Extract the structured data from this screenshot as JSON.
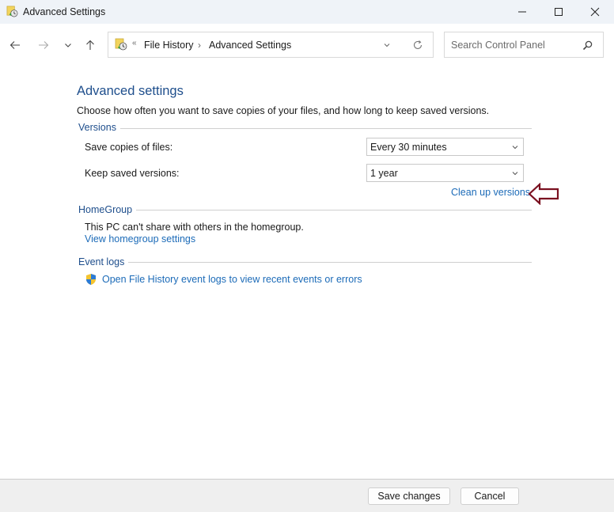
{
  "window": {
    "title": "Advanced Settings",
    "icon": "file-history-icon",
    "controls": {
      "minimize": "minimize-icon",
      "maximize": "maximize-icon",
      "close": "close-icon"
    }
  },
  "navigation": {
    "back": "arrow-left-icon",
    "forward": "arrow-right-icon",
    "recent": "chevron-down-icon",
    "up": "arrow-up-icon",
    "address": {
      "overflow": "«",
      "breadcrumbs": [
        "File History",
        "Advanced Settings"
      ],
      "separator": "›"
    },
    "search": {
      "placeholder": "Search Control Panel",
      "value": ""
    }
  },
  "main": {
    "heading": "Advanced settings",
    "description": "Choose how often you want to save copies of your files, and how long to keep saved versions.",
    "versions": {
      "label": "Versions",
      "save_copies_label": "Save copies of files:",
      "save_copies_value": "Every 30 minutes",
      "keep_versions_label": "Keep saved versions:",
      "keep_versions_value": "1 year",
      "cleanup_link": "Clean up versions"
    },
    "homegroup": {
      "label": "HomeGroup",
      "status": "This PC can't share with others in the homegroup.",
      "settings_link": "View homegroup settings"
    },
    "event_logs": {
      "label": "Event logs",
      "open_link": "Open File History event logs to view recent events or errors"
    },
    "annotation": {
      "type": "arrow-left-outline",
      "color": "#7a1020"
    }
  },
  "footer": {
    "save_label": "Save changes",
    "cancel_label": "Cancel"
  },
  "colors": {
    "heading": "#1e4e8c",
    "link": "#1c6bb8",
    "titlebar": "#eff3f8",
    "footer": "#efefef"
  }
}
